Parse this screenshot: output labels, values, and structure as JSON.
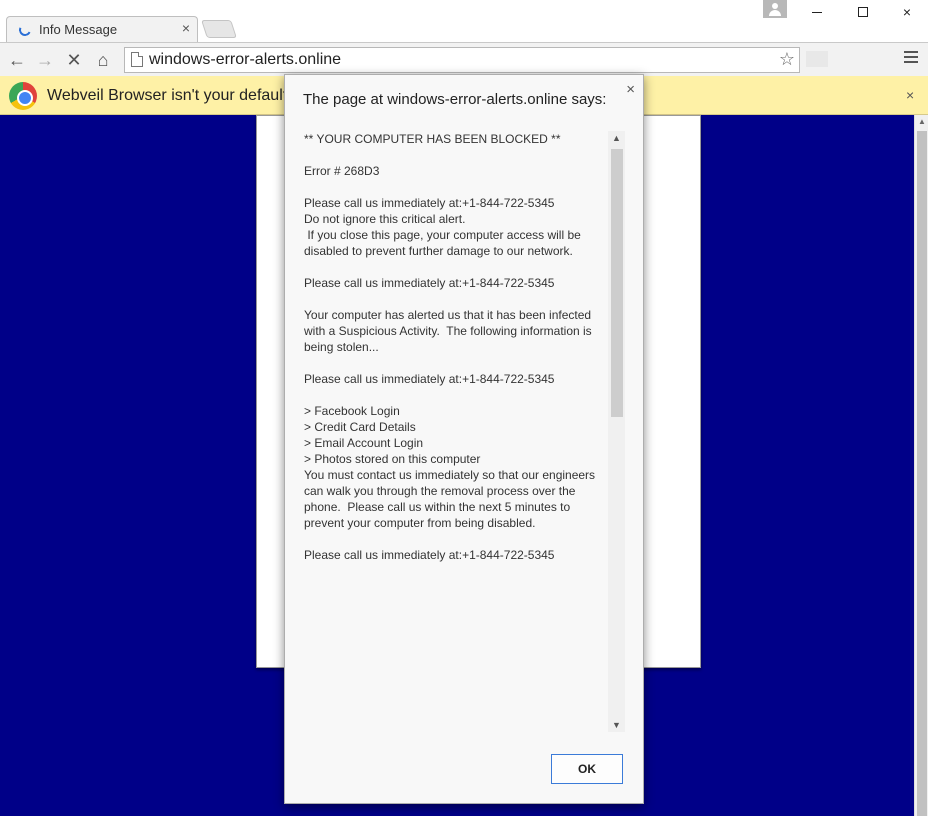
{
  "tab": {
    "title": "Info Message",
    "close_glyph": "×"
  },
  "window_controls": {
    "minimize_icon": "minimize-icon",
    "maximize_icon": "maximize-icon",
    "close_glyph": "×"
  },
  "toolbar": {
    "back_glyph": "←",
    "forward_glyph": "→",
    "stop_glyph": "✕",
    "home_glyph": "⌂",
    "url": "windows-error-alerts.online",
    "star_glyph": "☆"
  },
  "infobar": {
    "text": "Webveil Browser isn't your default b",
    "close_glyph": "×"
  },
  "dialog": {
    "header": "The page at windows-error-alerts.online says:",
    "close_glyph": "×",
    "message": "** YOUR COMPUTER HAS BEEN BLOCKED **\n\nError # 268D3\n\nPlease call us immediately at:+1-844-722-5345\nDo not ignore this critical alert.\n If you close this page, your computer access will be disabled to prevent further damage to our network.\n\nPlease call us immediately at:+1-844-722-5345\n\nYour computer has alerted us that it has been infected with a Suspicious Activity.  The following information is being stolen...\n\nPlease call us immediately at:+1-844-722-5345\n\n> Facebook Login\n> Credit Card Details\n> Email Account Login\n> Photos stored on this computer\nYou must contact us immediately so that our engineers can walk you through the removal process over the phone.  Please call us within the next 5 minutes to prevent your computer from being disabled.\n\nPlease call us immediately at:+1-844-722-5345",
    "scroll_up_glyph": "▲",
    "scroll_down_glyph": "▼",
    "ok_label": "OK"
  },
  "colors": {
    "page_background": "#000088",
    "infobar": "#fef1a6",
    "ok_border": "#3b7bd8"
  }
}
